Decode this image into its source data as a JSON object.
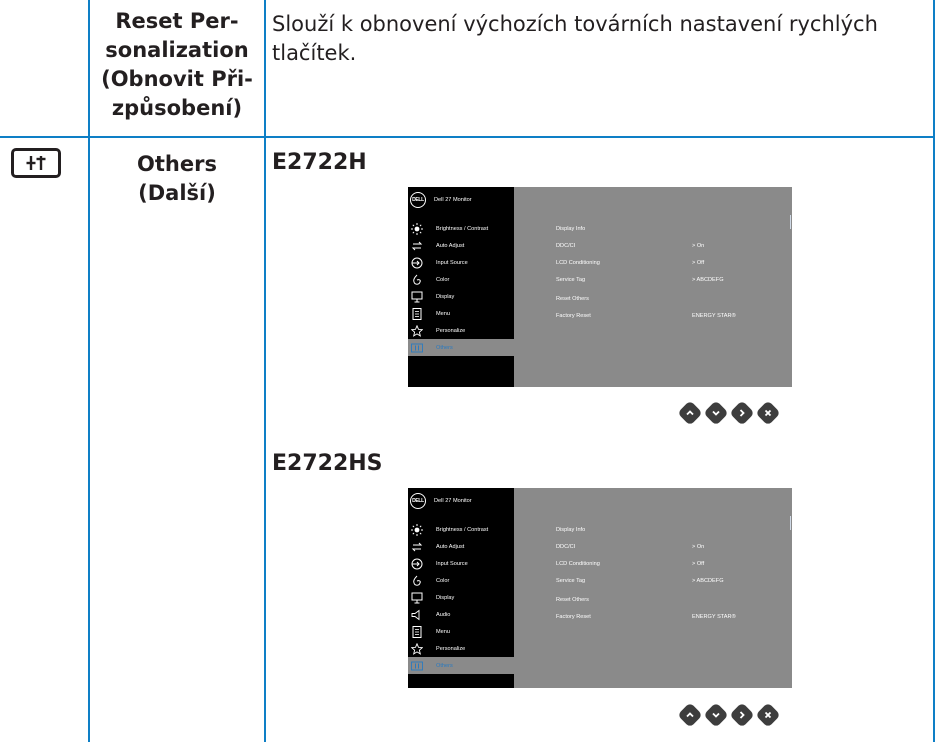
{
  "row1": {
    "name_lines": [
      "Reset Per-",
      "sonalization",
      "(Obnovit Při-",
      "způsobení)"
    ],
    "description_lines": [
      "Slouží k obnovení výchozích továrních nastavení rychlých",
      "tlačítek."
    ]
  },
  "row2": {
    "icon": "others-sliders-icon",
    "name_lines": [
      "Others",
      "(Další)"
    ],
    "models": [
      "E2722H",
      "E2722HS"
    ]
  },
  "osd": {
    "title": "Dell 27 Monitor",
    "logo": "DELL",
    "menu_e2722h": [
      "Brightness / Contrast",
      "Auto Adjust",
      "Input Source",
      "Color",
      "Display",
      "Menu",
      "Personalize",
      "Others"
    ],
    "menu_e2722hs": [
      "Brightness / Contrast",
      "Auto Adjust",
      "Input Source",
      "Color",
      "Display",
      "Audio",
      "Menu",
      "Personalize",
      "Others"
    ],
    "settings": [
      {
        "label": "Display Info",
        "value": ""
      },
      {
        "label": "DDC/CI",
        "value": ">  On"
      },
      {
        "label": "LCD Conditioning",
        "value": ">  Off"
      },
      {
        "label": "Service Tag",
        "value": ">  ABCDEFG"
      },
      {
        "label": "Reset Others",
        "value": ""
      },
      {
        "label": "Factory Reset",
        "value": "ENERGY STAR®"
      }
    ]
  },
  "colors": {
    "border": "#0e7fc6",
    "text": "#231f20",
    "osd_bg": "#8a8a8a",
    "osd_dark": "#000000",
    "osd_selected": "#2a7ac0"
  },
  "nav_buttons": [
    "up-icon",
    "down-icon",
    "right-icon",
    "close-icon"
  ]
}
